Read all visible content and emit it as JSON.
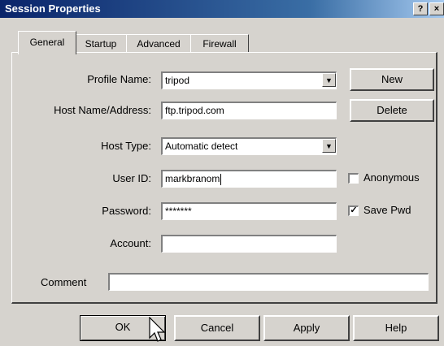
{
  "window": {
    "title": "Session Properties",
    "help_label": "?",
    "close_label": "×"
  },
  "tabs": [
    {
      "label": "General"
    },
    {
      "label": "Startup"
    },
    {
      "label": "Advanced"
    },
    {
      "label": "Firewall"
    }
  ],
  "form": {
    "profile_name": {
      "label": "Profile Name:",
      "value": "tripod"
    },
    "host": {
      "label": "Host Name/Address:",
      "value": "ftp.tripod.com"
    },
    "host_type": {
      "label": "Host Type:",
      "value": "Automatic detect"
    },
    "user_id": {
      "label": "User ID:",
      "value": "markbranom"
    },
    "password": {
      "label": "Password:",
      "value": "*******"
    },
    "account": {
      "label": "Account:",
      "value": ""
    },
    "comment": {
      "label": "Comment",
      "value": ""
    }
  },
  "side_buttons": {
    "new_label": "New",
    "delete_label": "Delete"
  },
  "checkboxes": {
    "anonymous": {
      "label": "Anonymous",
      "checked": false
    },
    "save_pwd": {
      "label": "Save Pwd",
      "checked": true,
      "mark": "✓"
    }
  },
  "footer": {
    "ok_label": "OK",
    "cancel_label": "Cancel",
    "apply_label": "Apply",
    "help_label": "Help"
  },
  "icons": {
    "dropdown": "down-arrow-icon",
    "pointer": "mouse-pointer-icon"
  }
}
